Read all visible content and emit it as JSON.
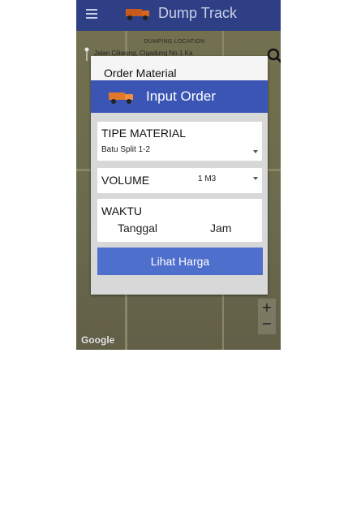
{
  "app": {
    "title": "Dump Track"
  },
  "search": {
    "label": "DUMPING LOCATION",
    "value": "Jalan Ciliwung, Cigadung No.1 Ka"
  },
  "dialog": {
    "title": "Order Material",
    "banner_title": "Input Order"
  },
  "material": {
    "label": "TIPE MATERIAL",
    "value": "Batu Split 1-2"
  },
  "volume": {
    "label": "VOLUME",
    "value": "1 M3"
  },
  "time": {
    "label": "WAKTU",
    "date_label": "Tanggal",
    "time_label": "Jam"
  },
  "actions": {
    "check_price": "Lihat Harga"
  },
  "map": {
    "zoom_in": "+",
    "zoom_out": "−",
    "attribution": "Google"
  },
  "colors": {
    "appbar": "#2f3f86",
    "banner": "#3b55b4",
    "button": "#4f6fcc"
  },
  "icons": [
    "menu-icon",
    "truck-icon",
    "pin-icon",
    "search-icon",
    "dropdown-icon"
  ]
}
